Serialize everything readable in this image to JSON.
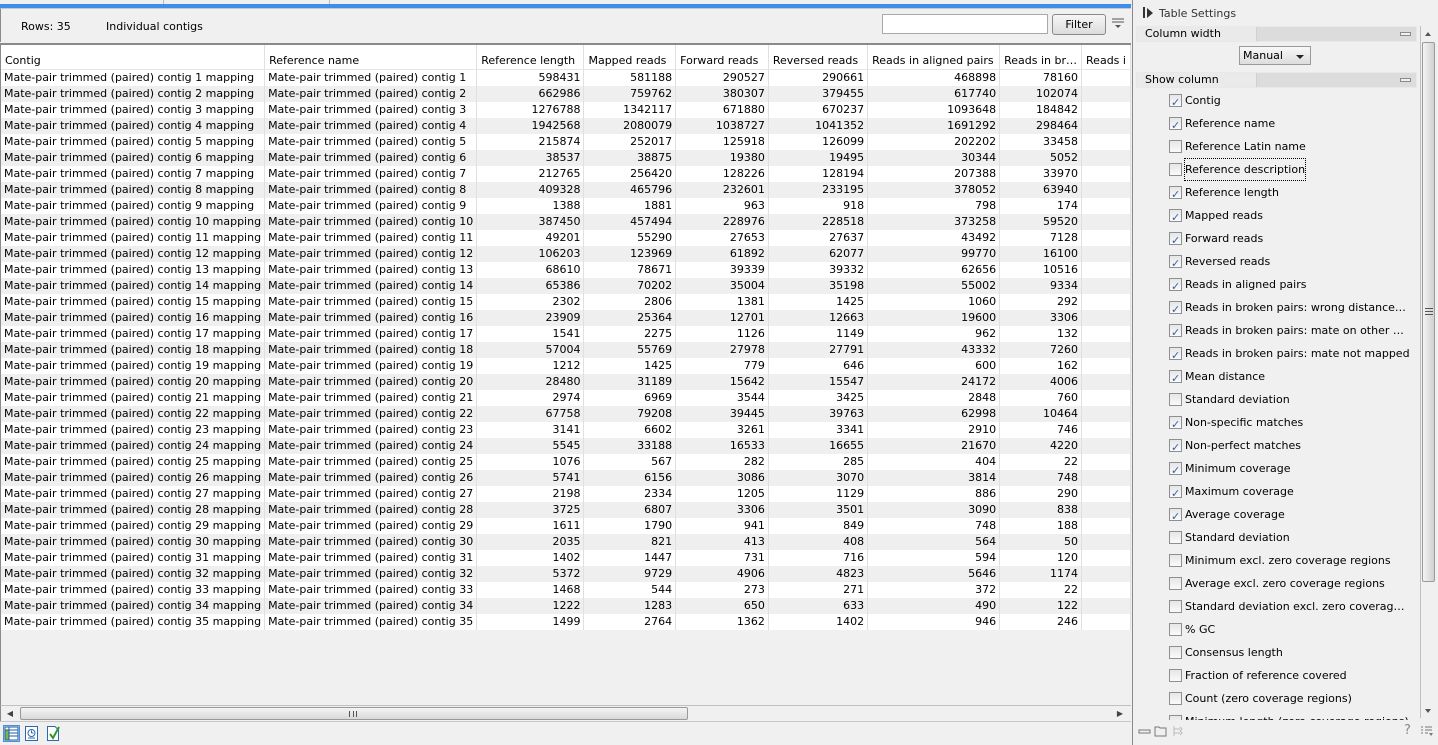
{
  "info_bar": {
    "rows_label": "Rows: 35",
    "subtitle": "Individual contigs",
    "filter_placeholder": "",
    "filter_value": "",
    "filter_button": "Filter"
  },
  "table": {
    "columns": [
      "Contig",
      "Reference name",
      "Reference length",
      "Mapped reads",
      "Forward reads",
      "Reversed reads",
      "Reads in aligned pairs",
      "Reads in br…",
      "Reads i"
    ],
    "rows": [
      [
        "Mate-pair trimmed (paired) contig 1 mapping",
        "Mate-pair trimmed (paired) contig 1",
        "598431",
        "581188",
        "290527",
        "290661",
        "468898",
        "78160",
        ""
      ],
      [
        "Mate-pair trimmed (paired) contig 2 mapping",
        "Mate-pair trimmed (paired) contig 2",
        "662986",
        "759762",
        "380307",
        "379455",
        "617740",
        "102074",
        ""
      ],
      [
        "Mate-pair trimmed (paired) contig 3 mapping",
        "Mate-pair trimmed (paired) contig 3",
        "1276788",
        "1342117",
        "671880",
        "670237",
        "1093648",
        "184842",
        ""
      ],
      [
        "Mate-pair trimmed (paired) contig 4 mapping",
        "Mate-pair trimmed (paired) contig 4",
        "1942568",
        "2080079",
        "1038727",
        "1041352",
        "1691292",
        "298464",
        ""
      ],
      [
        "Mate-pair trimmed (paired) contig 5 mapping",
        "Mate-pair trimmed (paired) contig 5",
        "215874",
        "252017",
        "125918",
        "126099",
        "202202",
        "33458",
        ""
      ],
      [
        "Mate-pair trimmed (paired) contig 6 mapping",
        "Mate-pair trimmed (paired) contig 6",
        "38537",
        "38875",
        "19380",
        "19495",
        "30344",
        "5052",
        ""
      ],
      [
        "Mate-pair trimmed (paired) contig 7 mapping",
        "Mate-pair trimmed (paired) contig 7",
        "212765",
        "256420",
        "128226",
        "128194",
        "207388",
        "33970",
        ""
      ],
      [
        "Mate-pair trimmed (paired) contig 8 mapping",
        "Mate-pair trimmed (paired) contig 8",
        "409328",
        "465796",
        "232601",
        "233195",
        "378052",
        "63940",
        ""
      ],
      [
        "Mate-pair trimmed (paired) contig 9 mapping",
        "Mate-pair trimmed (paired) contig 9",
        "1388",
        "1881",
        "963",
        "918",
        "798",
        "174",
        ""
      ],
      [
        "Mate-pair trimmed (paired) contig 10 mapping",
        "Mate-pair trimmed (paired) contig 10",
        "387450",
        "457494",
        "228976",
        "228518",
        "373258",
        "59520",
        ""
      ],
      [
        "Mate-pair trimmed (paired) contig 11 mapping",
        "Mate-pair trimmed (paired) contig 11",
        "49201",
        "55290",
        "27653",
        "27637",
        "43492",
        "7128",
        ""
      ],
      [
        "Mate-pair trimmed (paired) contig 12 mapping",
        "Mate-pair trimmed (paired) contig 12",
        "106203",
        "123969",
        "61892",
        "62077",
        "99770",
        "16100",
        ""
      ],
      [
        "Mate-pair trimmed (paired) contig 13 mapping",
        "Mate-pair trimmed (paired) contig 13",
        "68610",
        "78671",
        "39339",
        "39332",
        "62656",
        "10516",
        ""
      ],
      [
        "Mate-pair trimmed (paired) contig 14 mapping",
        "Mate-pair trimmed (paired) contig 14",
        "65386",
        "70202",
        "35004",
        "35198",
        "55002",
        "9334",
        ""
      ],
      [
        "Mate-pair trimmed (paired) contig 15 mapping",
        "Mate-pair trimmed (paired) contig 15",
        "2302",
        "2806",
        "1381",
        "1425",
        "1060",
        "292",
        ""
      ],
      [
        "Mate-pair trimmed (paired) contig 16 mapping",
        "Mate-pair trimmed (paired) contig 16",
        "23909",
        "25364",
        "12701",
        "12663",
        "19600",
        "3306",
        ""
      ],
      [
        "Mate-pair trimmed (paired) contig 17 mapping",
        "Mate-pair trimmed (paired) contig 17",
        "1541",
        "2275",
        "1126",
        "1149",
        "962",
        "132",
        ""
      ],
      [
        "Mate-pair trimmed (paired) contig 18 mapping",
        "Mate-pair trimmed (paired) contig 18",
        "57004",
        "55769",
        "27978",
        "27791",
        "43332",
        "7260",
        ""
      ],
      [
        "Mate-pair trimmed (paired) contig 19 mapping",
        "Mate-pair trimmed (paired) contig 19",
        "1212",
        "1425",
        "779",
        "646",
        "600",
        "162",
        ""
      ],
      [
        "Mate-pair trimmed (paired) contig 20 mapping",
        "Mate-pair trimmed (paired) contig 20",
        "28480",
        "31189",
        "15642",
        "15547",
        "24172",
        "4006",
        ""
      ],
      [
        "Mate-pair trimmed (paired) contig 21 mapping",
        "Mate-pair trimmed (paired) contig 21",
        "2974",
        "6969",
        "3544",
        "3425",
        "2848",
        "760",
        ""
      ],
      [
        "Mate-pair trimmed (paired) contig 22 mapping",
        "Mate-pair trimmed (paired) contig 22",
        "67758",
        "79208",
        "39445",
        "39763",
        "62998",
        "10464",
        ""
      ],
      [
        "Mate-pair trimmed (paired) contig 23 mapping",
        "Mate-pair trimmed (paired) contig 23",
        "3141",
        "6602",
        "3261",
        "3341",
        "2910",
        "746",
        ""
      ],
      [
        "Mate-pair trimmed (paired) contig 24 mapping",
        "Mate-pair trimmed (paired) contig 24",
        "5545",
        "33188",
        "16533",
        "16655",
        "21670",
        "4220",
        ""
      ],
      [
        "Mate-pair trimmed (paired) contig 25 mapping",
        "Mate-pair trimmed (paired) contig 25",
        "1076",
        "567",
        "282",
        "285",
        "404",
        "22",
        ""
      ],
      [
        "Mate-pair trimmed (paired) contig 26 mapping",
        "Mate-pair trimmed (paired) contig 26",
        "5741",
        "6156",
        "3086",
        "3070",
        "3814",
        "748",
        ""
      ],
      [
        "Mate-pair trimmed (paired) contig 27 mapping",
        "Mate-pair trimmed (paired) contig 27",
        "2198",
        "2334",
        "1205",
        "1129",
        "886",
        "290",
        ""
      ],
      [
        "Mate-pair trimmed (paired) contig 28 mapping",
        "Mate-pair trimmed (paired) contig 28",
        "3725",
        "6807",
        "3306",
        "3501",
        "3090",
        "838",
        ""
      ],
      [
        "Mate-pair trimmed (paired) contig 29 mapping",
        "Mate-pair trimmed (paired) contig 29",
        "1611",
        "1790",
        "941",
        "849",
        "748",
        "188",
        ""
      ],
      [
        "Mate-pair trimmed (paired) contig 30 mapping",
        "Mate-pair trimmed (paired) contig 30",
        "2035",
        "821",
        "413",
        "408",
        "564",
        "50",
        ""
      ],
      [
        "Mate-pair trimmed (paired) contig 31 mapping",
        "Mate-pair trimmed (paired) contig 31",
        "1402",
        "1447",
        "731",
        "716",
        "594",
        "120",
        ""
      ],
      [
        "Mate-pair trimmed (paired) contig 32 mapping",
        "Mate-pair trimmed (paired) contig 32",
        "5372",
        "9729",
        "4906",
        "4823",
        "5646",
        "1174",
        ""
      ],
      [
        "Mate-pair trimmed (paired) contig 33 mapping",
        "Mate-pair trimmed (paired) contig 33",
        "1468",
        "544",
        "273",
        "271",
        "372",
        "22",
        ""
      ],
      [
        "Mate-pair trimmed (paired) contig 34 mapping",
        "Mate-pair trimmed (paired) contig 34",
        "1222",
        "1283",
        "650",
        "633",
        "490",
        "122",
        ""
      ],
      [
        "Mate-pair trimmed (paired) contig 35 mapping",
        "Mate-pair trimmed (paired) contig 35",
        "1499",
        "2764",
        "1362",
        "1402",
        "946",
        "246",
        ""
      ]
    ]
  },
  "view_bar": {
    "icons": [
      "table-view-icon",
      "history-icon",
      "validation-icon"
    ]
  },
  "settings": {
    "title": "Table Settings",
    "column_width": {
      "label": "Column width",
      "selected": "Manual"
    },
    "show_column": {
      "label": "Show column",
      "items": [
        {
          "label": "Contig",
          "checked": true
        },
        {
          "label": "Reference name",
          "checked": true
        },
        {
          "label": "Reference Latin name",
          "checked": false
        },
        {
          "label": "Reference description",
          "checked": false,
          "focused": true
        },
        {
          "label": "Reference length",
          "checked": true
        },
        {
          "label": "Mapped reads",
          "checked": true
        },
        {
          "label": "Forward reads",
          "checked": true
        },
        {
          "label": "Reversed reads",
          "checked": true
        },
        {
          "label": "Reads in aligned pairs",
          "checked": true
        },
        {
          "label": "Reads in broken pairs: wrong distance…",
          "checked": true
        },
        {
          "label": "Reads in broken pairs: mate on other …",
          "checked": true
        },
        {
          "label": "Reads in broken pairs: mate not mapped",
          "checked": true
        },
        {
          "label": "Mean distance",
          "checked": true
        },
        {
          "label": "Standard deviation",
          "checked": false
        },
        {
          "label": "Non-specific matches",
          "checked": true
        },
        {
          "label": "Non-perfect matches",
          "checked": true
        },
        {
          "label": "Minimum coverage",
          "checked": true
        },
        {
          "label": "Maximum coverage",
          "checked": true
        },
        {
          "label": "Average coverage",
          "checked": true
        },
        {
          "label": "Standard deviation",
          "checked": false
        },
        {
          "label": "Minimum excl. zero coverage regions",
          "checked": false
        },
        {
          "label": "Average excl. zero coverage regions",
          "checked": false
        },
        {
          "label": "Standard deviation excl. zero coverag…",
          "checked": false
        },
        {
          "label": "% GC",
          "checked": false
        },
        {
          "label": "Consensus length",
          "checked": false
        },
        {
          "label": "Fraction of reference covered",
          "checked": false
        },
        {
          "label": "Count (zero coverage regions)",
          "checked": false
        },
        {
          "label": "Minimum length (zero coverage regions)",
          "checked": false
        }
      ]
    },
    "footer": {
      "help": "?"
    }
  }
}
